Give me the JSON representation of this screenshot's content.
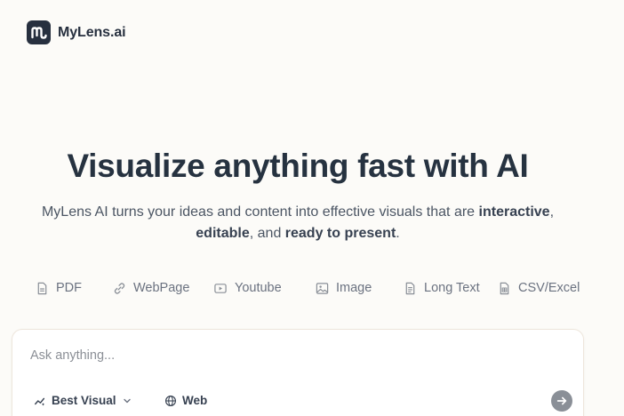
{
  "brand": {
    "name": "MyLens.ai"
  },
  "hero": {
    "title": "Visualize anything fast with AI",
    "subtitle_parts": {
      "p1": "MyLens AI turns your ideas and content into effective visuals that are ",
      "b1": "interactive",
      "p2": ",",
      "b2": "editable",
      "p3": ", and ",
      "b3": "ready to present",
      "p4": "."
    }
  },
  "sources": [
    {
      "label": "PDF",
      "icon": "file-icon"
    },
    {
      "label": "WebPage",
      "icon": "link-icon"
    },
    {
      "label": "Youtube",
      "icon": "video-icon"
    },
    {
      "label": "Image",
      "icon": "image-icon"
    },
    {
      "label": "Long Text",
      "icon": "document-icon"
    },
    {
      "label": "CSV/Excel",
      "icon": "spreadsheet-icon"
    }
  ],
  "composer": {
    "placeholder": "Ask anything...",
    "value": "",
    "mode_label": "Best Visual",
    "web_label": "Web"
  }
}
